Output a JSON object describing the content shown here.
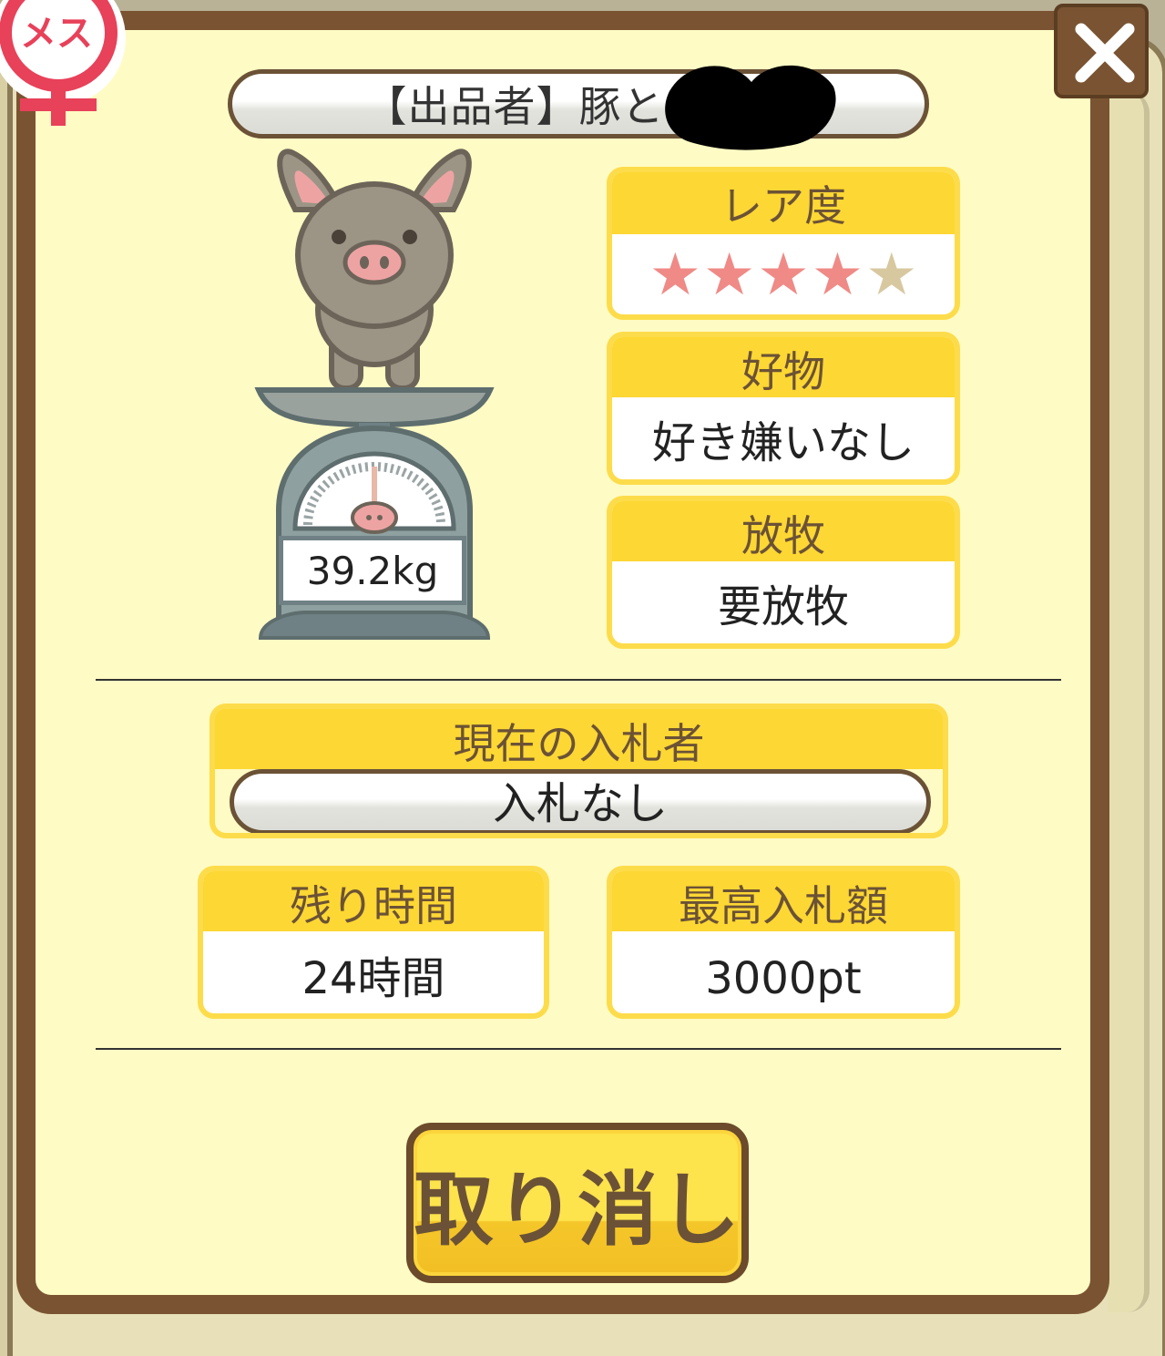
{
  "seller": {
    "label": "【出品者】豚と"
  },
  "pig": {
    "weight": "39.2kg"
  },
  "rarity": {
    "label": "レア度",
    "stars_filled": 4,
    "stars_total": 5,
    "star_on_color": "#ef8a86",
    "star_off_color": "#d8c8a0"
  },
  "favorite": {
    "label": "好物",
    "value": "好き嫌いなし"
  },
  "grazing": {
    "label": "放牧",
    "value": "要放牧"
  },
  "bidder": {
    "label": "現在の入札者",
    "value": "入札なし"
  },
  "time_left": {
    "label": "残り時間",
    "value": "24時間"
  },
  "max_bid": {
    "label": "最高入札額",
    "value": "3000pt"
  },
  "cancel": {
    "label": "取り消し"
  },
  "gender_badge": {
    "label": "メス",
    "icon": "female-symbol-icon"
  },
  "close": {
    "icon": "close-icon"
  }
}
